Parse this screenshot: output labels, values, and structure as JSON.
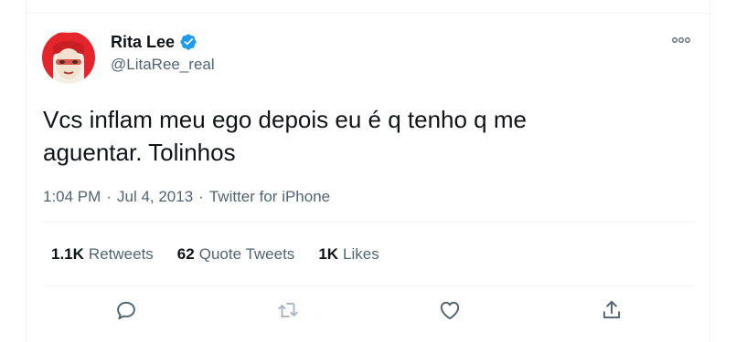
{
  "tweet": {
    "author": {
      "name": "Rita Lee",
      "handle": "@LitaRee_real",
      "verified": true
    },
    "text": "Vcs inflam meu ego depois eu é q tenho q me\naguentar. Tolinhos",
    "time": "1:04 PM",
    "date": "Jul 4, 2013",
    "separator": "·",
    "source": "Twitter for iPhone",
    "stats": {
      "retweets_count": "1.1K",
      "retweets_label": "Retweets",
      "quotes_count": "62",
      "quotes_label": "Quote Tweets",
      "likes_count": "1K",
      "likes_label": "Likes"
    }
  },
  "icons": {
    "more": "more-icon",
    "verified": "verified-badge-icon",
    "reply": "reply-icon",
    "retweet": "retweet-icon",
    "like": "like-icon",
    "share": "share-icon"
  },
  "colors": {
    "verified": "#1d9bf0",
    "text_primary": "#0f1419",
    "text_secondary": "#536471",
    "divider": "#eff3f4"
  }
}
